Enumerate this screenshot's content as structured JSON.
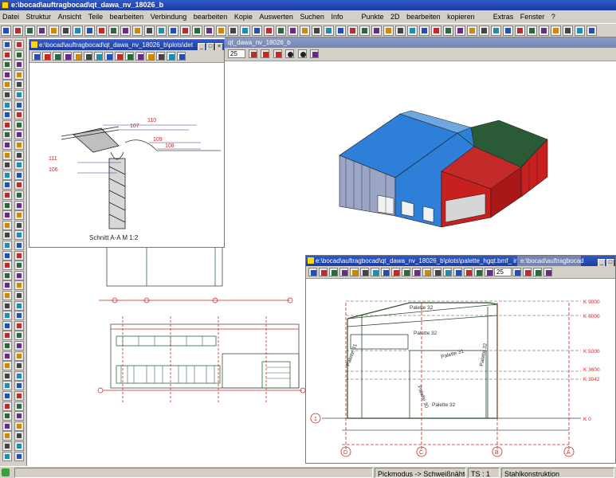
{
  "app": {
    "title": "e:\\bocad\\auftragbocad\\qt_dawa_nv_18026_b"
  },
  "menu": [
    "Datei",
    "Struktur",
    "Ansicht",
    "Teile",
    "bearbeiten",
    "Verbindung",
    "bearbeiten",
    "Kopie",
    "Auswerten",
    "Suchen",
    "Info",
    "Punkte",
    "2D",
    "bearbeiten",
    "kopieren",
    "Extras",
    "Fenster",
    "?"
  ],
  "main_view": {
    "title_fragment": "qt_dawa_nv_18026_b",
    "zoom": "25"
  },
  "detail_window": {
    "title": "e:\\bocad\\auftragbocad\\qt_dawa_nv_18026_b\\plots\\det",
    "section_label": "Schnitt A-A    M 1:2",
    "callouts": [
      "110",
      "107",
      "109",
      "108",
      "111",
      "106"
    ]
  },
  "palette_window": {
    "title": "e:\\bocad\\auftragbocad\\qt_dawa_nv_18026_b\\plots\\palette_hgqt.bmf_ in",
    "title_tail": "e:\\bocad\\auftragbocad",
    "zoom": "25",
    "levels": [
      "K 9000",
      "K 8000",
      "K 5000",
      "K 3600",
      "K 3042",
      "K 0"
    ],
    "axes": [
      "D",
      "C",
      "B",
      "A"
    ],
    "palettes": [
      "Palette 32",
      "Palette 32",
      "Palette 31",
      "Palette 31",
      "Palette 30",
      "Palette 32",
      "Palette 32"
    ],
    "axis_tag": "1"
  },
  "status": {
    "pick_mode": "Pickmodus -> Schweißnähte",
    "ts": "TS : 1",
    "category": "Stahlkonstruktion"
  },
  "colors": {
    "title_blue": "#1c3da0",
    "building_blue": "#2e7fd8",
    "building_red": "#cc1f1f",
    "roof_green": "#2a6a3a",
    "drawing_red": "#c62828"
  }
}
